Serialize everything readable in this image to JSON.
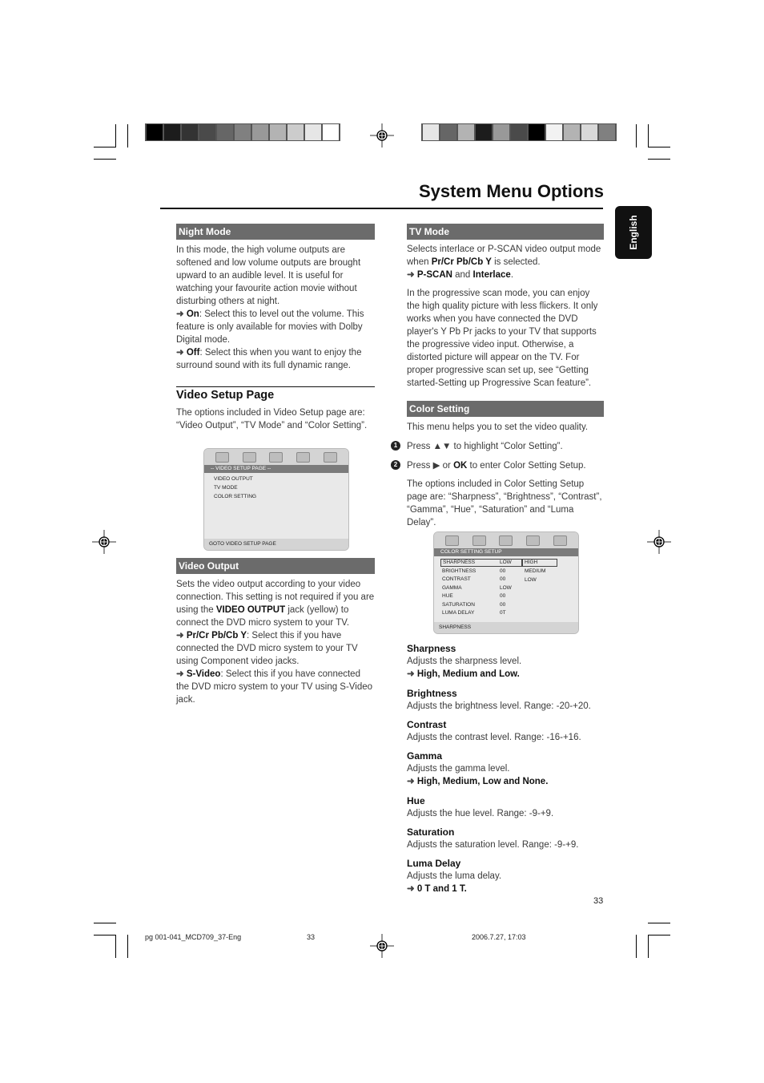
{
  "header": {
    "title": "System Menu Options",
    "language_tab": "English"
  },
  "color_bars": {
    "left": [
      "#000000",
      "#1c1c1c",
      "#333333",
      "#4a4a4a",
      "#666666",
      "#808080",
      "#999999",
      "#b3b3b3",
      "#cccccc",
      "#e6e6e6",
      "#ffffff"
    ],
    "right": [
      "#e6e6e6",
      "#666666",
      "#b3b3b3",
      "#1c1c1c",
      "#999999",
      "#4a4a4a",
      "#000000",
      "#f2f2f2",
      "#b3b3b3",
      "#d9d9d9",
      "#808080"
    ]
  },
  "left_column": {
    "night_mode": {
      "heading": "Night Mode",
      "intro": "In this mode, the high volume outputs are softened and low volume outputs are brought upward to an audible level. It is useful for watching your favourite action movie without disturbing others at night.",
      "options": [
        {
          "arrow": "➜",
          "label": "On",
          "text": ": Select this to level out the volume. This feature is only available for movies with Dolby Digital mode."
        },
        {
          "arrow": "➜",
          "label": "Off",
          "text": ": Select this when you want to enjoy the surround sound with its full dynamic range."
        }
      ]
    },
    "video_setup": {
      "heading": "Video Setup Page",
      "text": "The options included in Video Setup page are: “Video Output”, “TV Mode” and “Color Setting”.",
      "screen": {
        "header": "-- VIDEO SETUP PAGE --",
        "items": [
          "VIDEO OUTPUT",
          "TV MODE",
          "COLOR SETTING"
        ],
        "footer": "GOTO VIDEO SETUP PAGE"
      }
    },
    "video_output": {
      "heading": "Video Output",
      "intro_a": "Sets the video output according to your video connection. This setting is not required if you are using the ",
      "intro_bold": "VIDEO OUTPUT",
      "intro_b": " jack (yellow) to connect the DVD micro system to your TV.",
      "options": [
        {
          "arrow": "➜",
          "label": "Pr/Cr Pb/Cb Y",
          "text": ": Select this if you have connected the DVD micro system to your TV using Component video jacks."
        },
        {
          "arrow": "➜",
          "label": "S-Video",
          "text": ": Select this if you have connected the DVD micro system to your TV using S-Video jack."
        }
      ]
    }
  },
  "right_column": {
    "tv_mode": {
      "heading": "TV Mode",
      "intro_a": "Selects interlace or P-SCAN video output mode when ",
      "intro_bold": "Pr/Cr Pb/Cb Y",
      "intro_b": " is selected.",
      "opt_arrow": "➜",
      "opt_1": "P-SCAN",
      "opt_and": " and ",
      "opt_2": "Interlace",
      "opt_end": ".",
      "para": "In the progressive scan mode, you can enjoy the high quality picture with less flickers. It only works when you have connected the DVD player's Y Pb Pr jacks to your TV that supports the progressive video input. Otherwise, a distorted picture will appear on the TV. For proper progressive scan set up, see “Getting started-Setting up Progressive Scan feature”."
    },
    "color_setting": {
      "heading": "Color Setting",
      "intro": "This menu helps you to set the video quality.",
      "steps": [
        {
          "num": "1",
          "a": "Press ▲▼  to highlight “Color Setting”.",
          "bold": "",
          "b": ""
        },
        {
          "num": "2",
          "a": "Press ▶ or ",
          "bold": "OK",
          "b": " to enter Color Setting Setup."
        }
      ],
      "options_text": "The options included in Color Setting Setup page are: “Sharpness”, “Brightness”, “Contrast”, “Gamma”, “Hue”, “Saturation” and “Luma Delay”.",
      "screen": {
        "header": "COLOR SETTING SETUP",
        "rows": [
          {
            "name": "SHARPNESS",
            "value": "LOW"
          },
          {
            "name": "BRIGHTNESS",
            "value": "00"
          },
          {
            "name": "CONTRAST",
            "value": "00"
          },
          {
            "name": "GAMMA",
            "value": "LOW"
          },
          {
            "name": "HUE",
            "value": "00"
          },
          {
            "name": "SATURATION",
            "value": "00"
          },
          {
            "name": "LUMA DELAY",
            "value": "0T"
          }
        ],
        "submenu": [
          "HIGH",
          "MEDIUM",
          "LOW"
        ],
        "footer": "SHARPNESS"
      }
    },
    "items": [
      {
        "title": "Sharpness",
        "desc": "Adjusts the sharpness level.",
        "opts": "High, Medium and Low."
      },
      {
        "title": "Brightness",
        "desc": "Adjusts the brightness level. Range: -20-+20.",
        "opts": ""
      },
      {
        "title": "Contrast",
        "desc": "Adjusts the contrast level. Range: -16-+16.",
        "opts": ""
      },
      {
        "title": "Gamma",
        "desc": "Adjusts the gamma level.",
        "opts": "High, Medium, Low and None."
      },
      {
        "title": "Hue",
        "desc": "Adjusts the hue level. Range: -9-+9.",
        "opts": ""
      },
      {
        "title": "Saturation",
        "desc": "Adjusts the saturation level. Range: -9-+9.",
        "opts": ""
      },
      {
        "title": "Luma Delay",
        "desc": "Adjusts the luma delay.",
        "opts": "0 T and 1 T."
      }
    ],
    "page_number": "33"
  },
  "footer": {
    "file": "pg 001-041_MCD709_37-Eng",
    "page": "33",
    "date": "2006.7.27, 17:03"
  }
}
